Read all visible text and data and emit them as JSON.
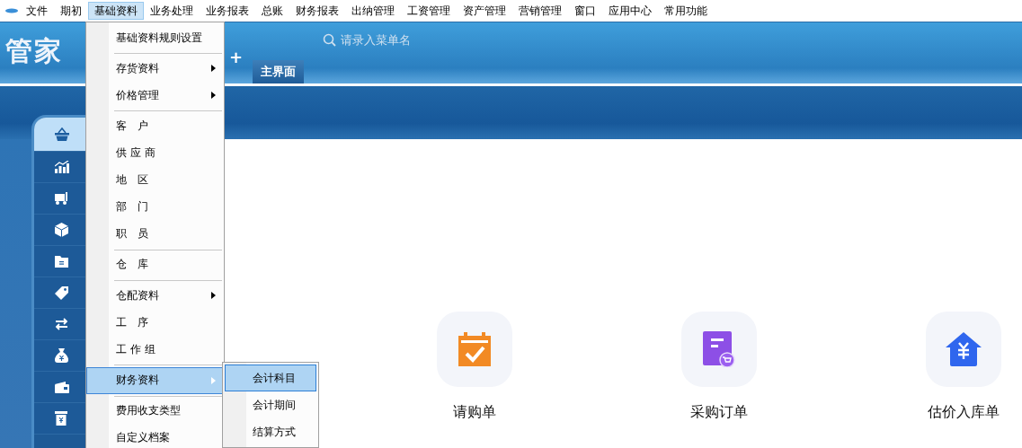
{
  "menubar": [
    {
      "label": "文件",
      "selected": false
    },
    {
      "label": "期初",
      "selected": false
    },
    {
      "label": "基础资料",
      "selected": true
    },
    {
      "label": "业务处理",
      "selected": false
    },
    {
      "label": "业务报表",
      "selected": false
    },
    {
      "label": "总账",
      "selected": false
    },
    {
      "label": "财务报表",
      "selected": false
    },
    {
      "label": "出纳管理",
      "selected": false
    },
    {
      "label": "工资管理",
      "selected": false
    },
    {
      "label": "资产管理",
      "selected": false
    },
    {
      "label": "营销管理",
      "selected": false
    },
    {
      "label": "窗口",
      "selected": false
    },
    {
      "label": "应用中心",
      "selected": false
    },
    {
      "label": "常用功能",
      "selected": false
    }
  ],
  "header": {
    "logo": "管家",
    "logo_suffix": "+",
    "search": {
      "placeholder": "请录入菜单名"
    },
    "tabs": [
      {
        "label": "主界面",
        "selected": true
      }
    ]
  },
  "sidebar": {
    "items": [
      {
        "kind": "basket",
        "selected": true
      },
      {
        "kind": "chart",
        "selected": false
      },
      {
        "kind": "truck",
        "selected": false
      },
      {
        "kind": "box",
        "selected": false
      },
      {
        "kind": "folder",
        "selected": false
      },
      {
        "kind": "tag",
        "selected": false
      },
      {
        "kind": "swap",
        "selected": false
      },
      {
        "kind": "moneybag",
        "selected": false
      },
      {
        "kind": "wallet",
        "selected": false
      },
      {
        "kind": "cashier",
        "selected": false
      }
    ]
  },
  "dropdown": {
    "sections": [
      [
        {
          "label": "基础资料规则设置",
          "submenu": false,
          "selected": false
        }
      ],
      [
        {
          "label": "存货资料",
          "submenu": true,
          "selected": false
        },
        {
          "label": "价格管理",
          "submenu": true,
          "selected": false
        }
      ],
      [
        {
          "label": "客　户",
          "submenu": false,
          "selected": false
        },
        {
          "label": "供 应 商",
          "submenu": false,
          "selected": false
        },
        {
          "label": "地　区",
          "submenu": false,
          "selected": false
        },
        {
          "label": "部　门",
          "submenu": false,
          "selected": false
        },
        {
          "label": "职　员",
          "submenu": false,
          "selected": false
        }
      ],
      [
        {
          "label": "仓　库",
          "submenu": false,
          "selected": false
        }
      ],
      [
        {
          "label": "仓配资料",
          "submenu": true,
          "selected": false
        },
        {
          "label": "工　序",
          "submenu": false,
          "selected": false
        },
        {
          "label": "工 作 组",
          "submenu": false,
          "selected": false
        }
      ],
      [
        {
          "label": "财务资料",
          "submenu": true,
          "selected": true
        }
      ],
      [
        {
          "label": "费用收支类型",
          "submenu": false,
          "selected": false
        },
        {
          "label": "自定义档案",
          "submenu": false,
          "selected": false
        }
      ]
    ]
  },
  "submenu": {
    "items": [
      {
        "label": "会计科目",
        "selected": true
      },
      {
        "label": "会计期间",
        "selected": false
      },
      {
        "label": "结算方式",
        "selected": false
      }
    ]
  },
  "tiles": [
    {
      "kind": "request",
      "label": "请购单"
    },
    {
      "kind": "order",
      "label": "采购订单"
    },
    {
      "kind": "warehouse",
      "label": "估价入库单"
    }
  ]
}
